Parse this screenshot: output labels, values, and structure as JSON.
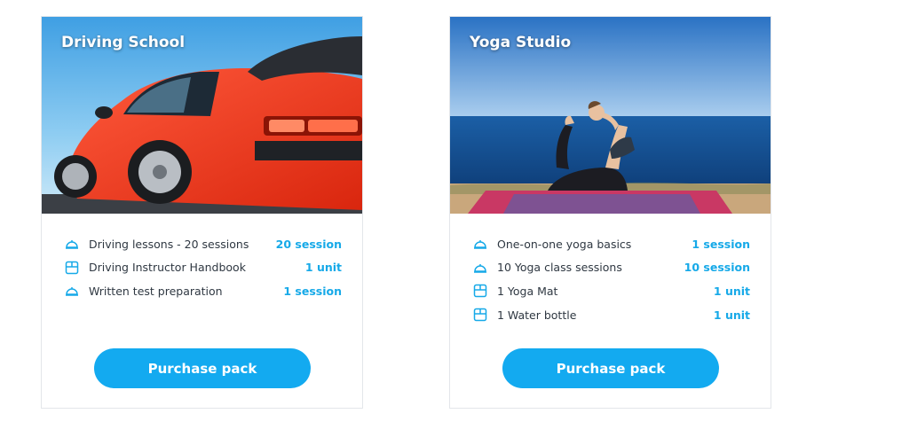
{
  "accent_color": "#13aaf0",
  "qty_color": "#16a9e8",
  "cards": [
    {
      "title": "Driving School",
      "image": "red sports car against blue sky",
      "items": [
        {
          "icon": "service-bell-icon",
          "label": "Driving lessons - 20 sessions",
          "qty": "20 session"
        },
        {
          "icon": "box-icon",
          "label": "Driving Instructor Handbook",
          "qty": "1 unit"
        },
        {
          "icon": "service-bell-icon",
          "label": "Written test preparation",
          "qty": "1 session"
        }
      ],
      "button_label": "Purchase pack"
    },
    {
      "title": "Yoga Studio",
      "image": "woman doing yoga pose by the sea",
      "items": [
        {
          "icon": "service-bell-icon",
          "label": "One-on-one yoga basics",
          "qty": "1 session"
        },
        {
          "icon": "service-bell-icon",
          "label": "10 Yoga class sessions",
          "qty": "10 session"
        },
        {
          "icon": "box-icon",
          "label": "1 Yoga Mat",
          "qty": "1 unit"
        },
        {
          "icon": "box-icon",
          "label": "1 Water bottle",
          "qty": "1 unit"
        }
      ],
      "button_label": "Purchase pack"
    }
  ]
}
